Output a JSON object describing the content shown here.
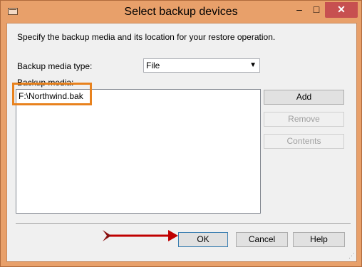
{
  "window": {
    "title": "Select backup devices",
    "minimize": "–",
    "maximize": "□",
    "close": "✕"
  },
  "instruction": "Specify the backup media and its location for your restore operation.",
  "media_type": {
    "label": "Backup media type:",
    "value": "File",
    "arrow": "▼"
  },
  "media": {
    "label": "Backup media:",
    "items": [
      "F:\\Northwind.bak"
    ]
  },
  "buttons": {
    "add": "Add",
    "remove": "Remove",
    "contents": "Contents",
    "ok": "OK",
    "cancel": "Cancel",
    "help": "Help"
  },
  "colors": {
    "highlight": "#e8821e",
    "arrow": "#c00000",
    "frame": "#e8a06a"
  },
  "icons": {
    "resize_grip": "⋰"
  }
}
